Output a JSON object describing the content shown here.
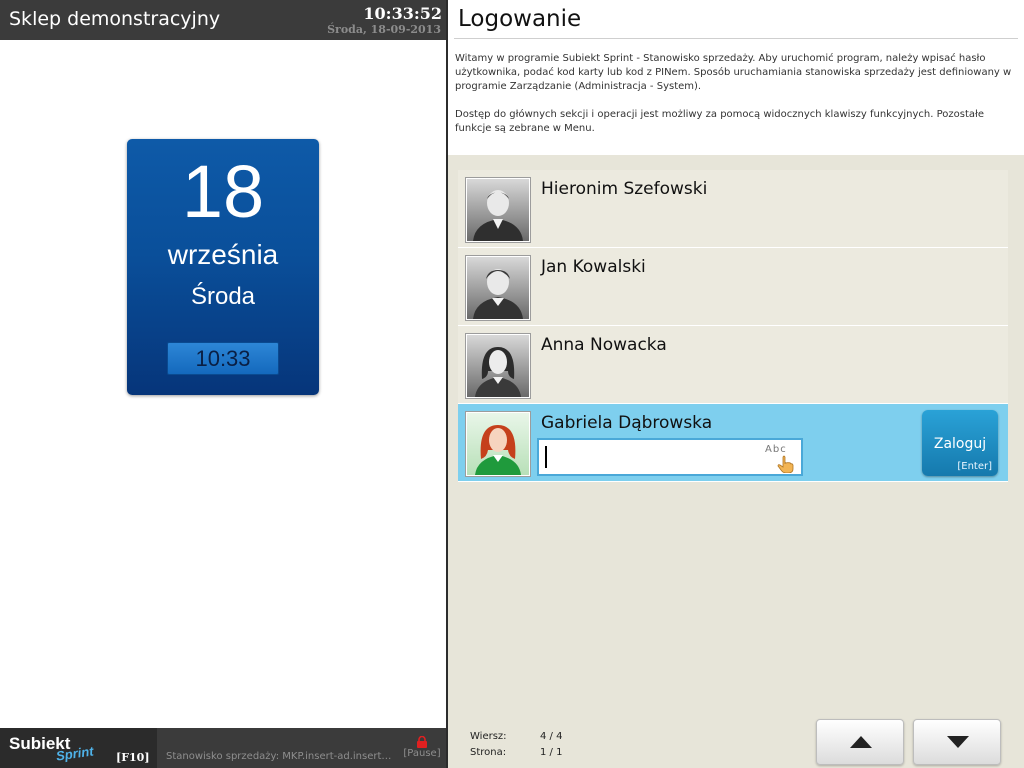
{
  "left": {
    "store_name": "Sklep demonstracyjny",
    "clock": "10:33:52",
    "date": "Środa, 18-09-2013",
    "calendar": {
      "day": "18",
      "month": "września",
      "weekday": "Środa",
      "time": "10:33"
    },
    "bottom": {
      "logo_main": "Subiekt",
      "logo_sub": "Sprint",
      "menu_key": "[F10]",
      "station": "Stanowisko sprzedaży: MKP.insert-ad.insert....",
      "pause": "[Pause]",
      "pause_icon": "lock-icon"
    }
  },
  "right": {
    "title": "Logowanie",
    "intro1": "Witamy w programie Subiekt Sprint - Stanowisko sprzedaży. Aby uruchomić program, należy wpisać hasło użytkownika, podać kod karty lub kod z PINem. Sposób uruchamiania stanowiska sprzedaży jest definiowany w programie Zarządzanie (Administracja - System).",
    "intro2": "Dostęp do głównych sekcji i operacji jest możliwy za pomocą widocznych klawiszy funkcyjnych. Pozostałe funkcje są zebrane w Menu.",
    "users": [
      {
        "name": "Hieronim Szefowski",
        "avatar": "male-avatar-icon"
      },
      {
        "name": "Jan Kowalski",
        "avatar": "male-avatar-icon"
      },
      {
        "name": "Anna Nowacka",
        "avatar": "female-avatar-icon"
      },
      {
        "name": "Gabriela Dąbrowska",
        "avatar": "female-avatar-color-icon",
        "selected": true
      }
    ],
    "password": {
      "value": "",
      "keyboard_label": "Abc"
    },
    "login": {
      "label": "Zaloguj",
      "key": "[Enter]"
    },
    "footer": {
      "row_label": "Wiersz:",
      "row_value": "4 / 4",
      "page_label": "Strona:",
      "page_value": "1 / 1"
    },
    "colors": {
      "selected_row": "#7ecfee",
      "login_button": "#1e8fc4",
      "calendar": "#0a4f9a"
    }
  }
}
